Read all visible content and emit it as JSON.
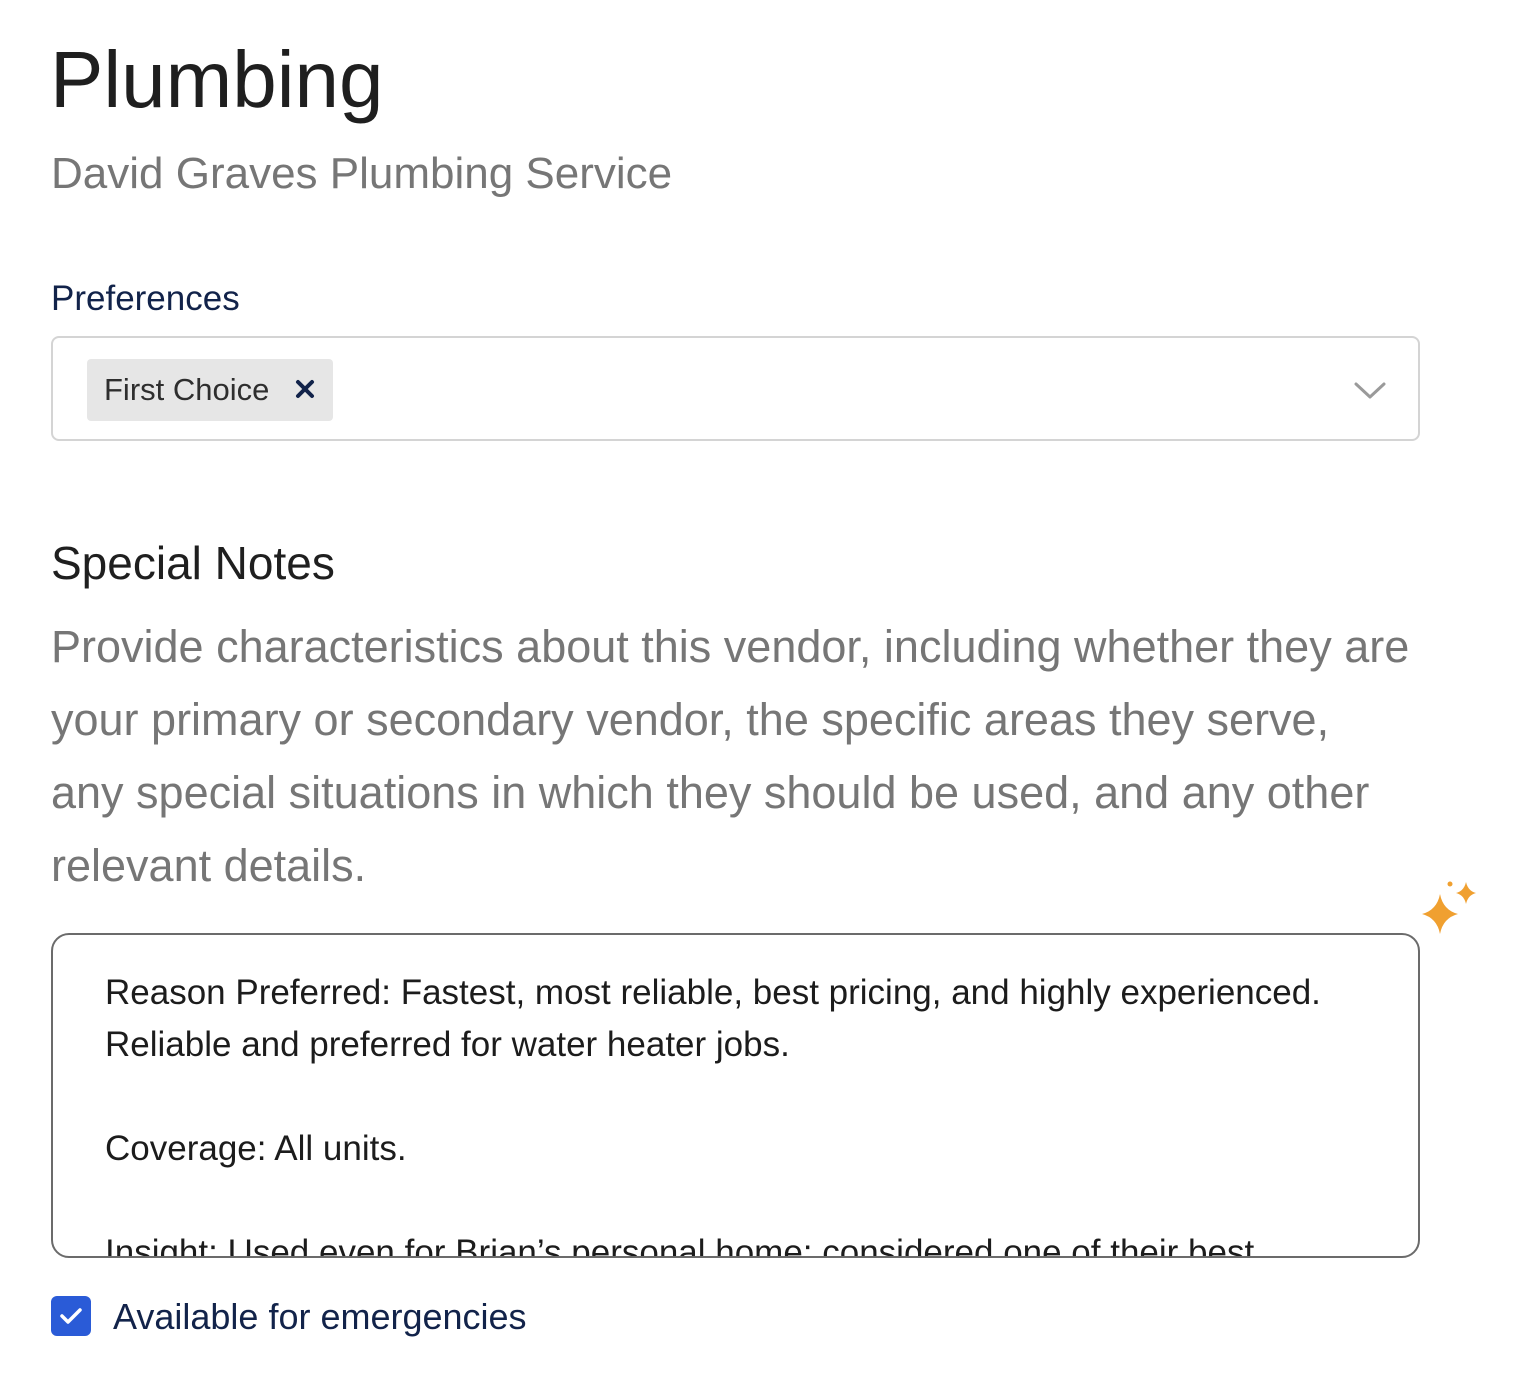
{
  "header": {
    "title": "Plumbing",
    "subtitle": "David Graves Plumbing Service"
  },
  "preferences": {
    "label": "Preferences",
    "selected_chips": [
      "First Choice"
    ],
    "dropdown_icon": "chevron-down-icon",
    "remove_icon": "close-icon"
  },
  "special_notes": {
    "heading": "Special Notes",
    "help_text": "Provide characteristics about this vendor, including whether they are your primary or secondary vendor, the specific areas they serve, any special situations in which they should be used, and any other relevant details.",
    "ai_icon": "sparkle-icon",
    "paragraphs": [
      "Reason Preferred: Fastest, most reliable, best pricing, and highly experienced. Reliable and preferred for water heater jobs.",
      "Coverage: All units.",
      "Insight: Used even for Brian’s personal home; considered one of their best"
    ]
  },
  "emergency": {
    "label": "Available for emergencies",
    "checked": true
  },
  "colors": {
    "checkbox": "#2a5bd7",
    "sparkle": "#f0a030",
    "label_navy": "#12234a"
  }
}
